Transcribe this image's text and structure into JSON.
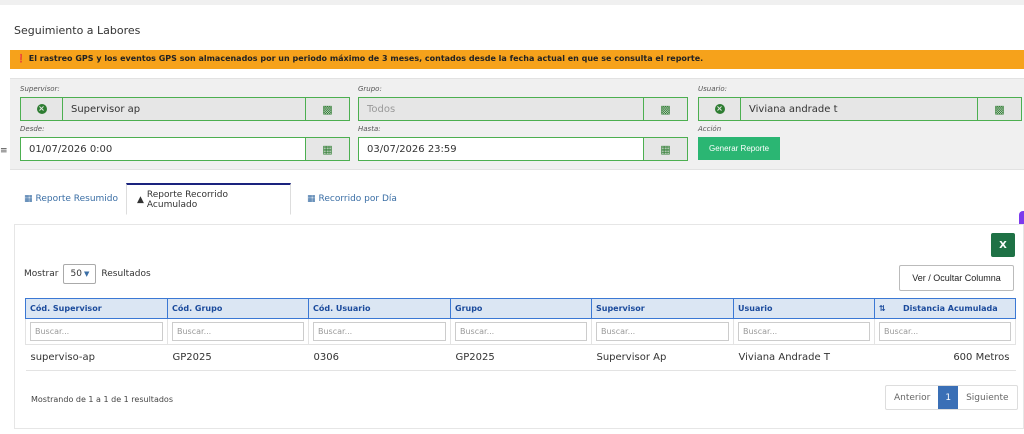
{
  "page": {
    "title": "Seguimiento a Labores"
  },
  "alert": {
    "text": "El rastreo GPS y los eventos GPS son almacenados por un periodo máximo de 3 meses, contados desde la fecha actual en que se consulta el reporte."
  },
  "filters": {
    "supervisor": {
      "label": "Supervisor:",
      "value": "Supervisor ap"
    },
    "grupo": {
      "label": "Grupo:",
      "placeholder": "Todos"
    },
    "usuario": {
      "label": "Usuario:",
      "value": "Viviana andrade t"
    },
    "desde": {
      "label": "Desde:",
      "value": "01/07/2026 0:00"
    },
    "hasta": {
      "label": "Hasta:",
      "value": "03/07/2026 23:59"
    },
    "accion": {
      "label": "Acción",
      "button": "Generar Reporte"
    }
  },
  "tabs": [
    {
      "label": "Reporte Resumido",
      "icon": "table-icon"
    },
    {
      "label": "Reporte Recorrido Acumulado",
      "icon": "road-icon"
    },
    {
      "label": "Recorrido por Día",
      "icon": "calendar-icon"
    }
  ],
  "table_controls": {
    "show_label": "Mostrar",
    "page_size": "50",
    "results_label": "Resultados",
    "columns_button": "Ver / Ocultar Columna",
    "excel_label": "X"
  },
  "table": {
    "columns": [
      "Cód. Supervisor",
      "Cód. Grupo",
      "Cód. Usuario",
      "Grupo",
      "Supervisor",
      "Usuario",
      "Distancia Acumulada"
    ],
    "search_placeholder": "Buscar...",
    "rows": [
      [
        "superviso-ap",
        "GP2025",
        "0306",
        "GP2025",
        "Supervisor Ap",
        "Viviana Andrade T",
        "600 Metros"
      ]
    ]
  },
  "footer": {
    "summary": "Mostrando de 1 a 1 de 1 resultados",
    "prev": "Anterior",
    "page": "1",
    "next": "Siguiente"
  },
  "colors": {
    "accent_green": "#2bb673",
    "alert_orange": "#f6a21b",
    "link_blue": "#3a6ea5"
  }
}
